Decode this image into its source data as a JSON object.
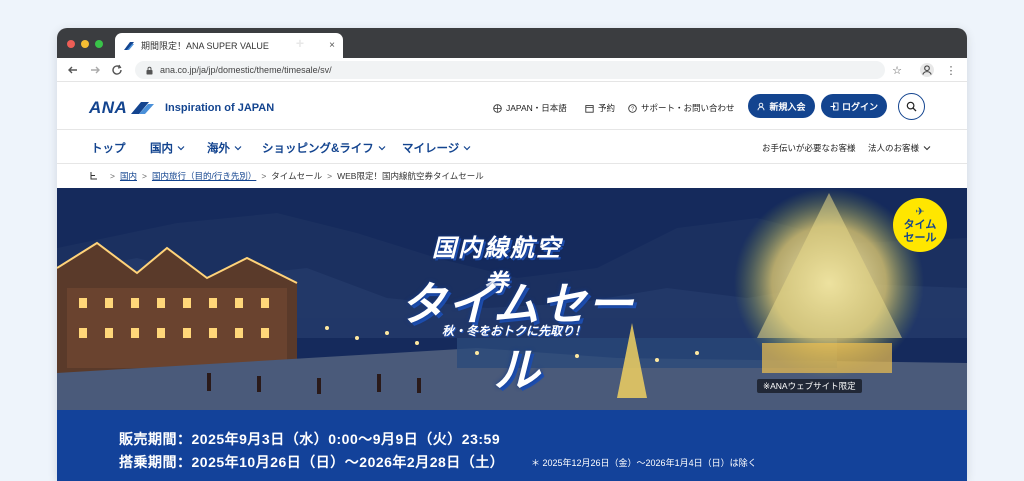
{
  "browser": {
    "tab_title": "期間限定！ANA SUPER VALUE",
    "tab_close": "×",
    "new_tab": "+",
    "url": "ana.co.jp/ja/jp/domestic/theme/timesale/sv/"
  },
  "header": {
    "logo_text": "ANA",
    "tagline": "Inspiration of JAPAN",
    "lang": "JAPAN・日本語",
    "reserve": "予約",
    "support": "サポート・お問い合わせ",
    "join": "新規入会",
    "login": "ログイン"
  },
  "nav": {
    "items": [
      "トップ",
      "国内",
      "海外",
      "ショッピング&ライフ",
      "マイレージ"
    ],
    "help": "お手伝いが必要なお客様",
    "corporate": "法人のお客様"
  },
  "breadcrumb": {
    "items": [
      "国内",
      "国内旅行（目的/行き先別）",
      "タイムセール",
      "WEB限定！国内線航空券タイムセール"
    ]
  },
  "hero": {
    "line1": "国内線航空券",
    "line2": "タイムセール",
    "sub": "秋・冬をおトクに先取り！",
    "badge_line1": "タイム",
    "badge_line2": "セール",
    "web_only": "※ANAウェブサイト限定"
  },
  "sale": {
    "period": "販売期間：2025年9月3日（水）0:00〜9月9日（火）23:59",
    "boarding": "搭乗期間：2025年10月26日（日）〜2026年2月28日（土）",
    "note": "＊ 2025年12月26日（金）〜2026年1月4日（日）は除く"
  },
  "colors": {
    "brand": "#13448f",
    "badge": "#ffe600",
    "sale_bg": "#13429a"
  }
}
